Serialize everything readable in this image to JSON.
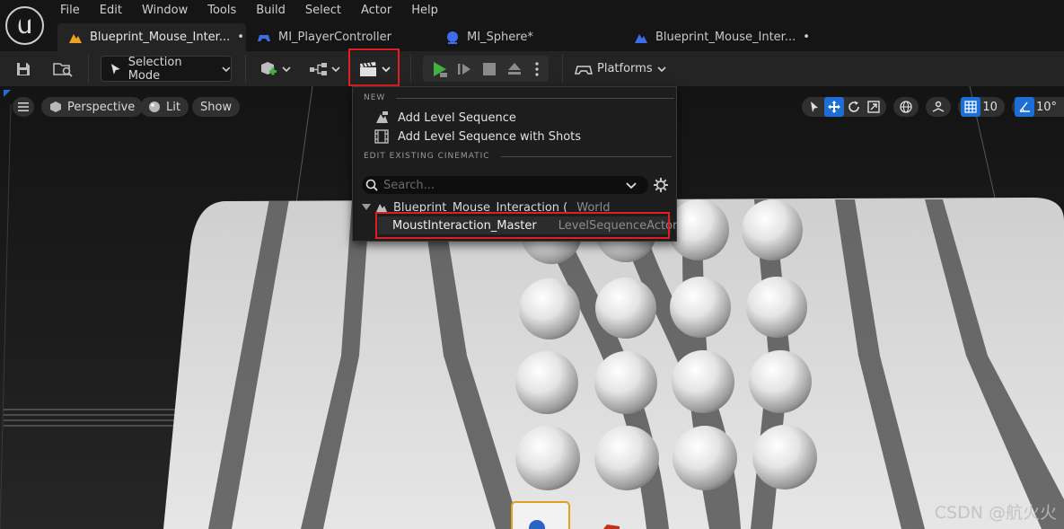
{
  "menubar": {
    "items": [
      "File",
      "Edit",
      "Window",
      "Tools",
      "Build",
      "Select",
      "Actor",
      "Help"
    ]
  },
  "tabs": [
    {
      "label": "Blueprint_Mouse_Inter...",
      "modified": "•",
      "icon": "level-icon",
      "icon_color": "#f0a020",
      "active": true
    },
    {
      "label": "MI_PlayerController",
      "modified": "",
      "icon": "gamepad-icon",
      "icon_color": "#3b6ee8",
      "active": false
    },
    {
      "label": "MI_Sphere",
      "modified": "*",
      "icon": "material-sphere-icon",
      "icon_color": "#3b6ee8",
      "active": false
    },
    {
      "label": "Blueprint_Mouse_Inter...",
      "modified": "•",
      "icon": "level-icon",
      "icon_color": "#3b6ee8",
      "active": false
    }
  ],
  "toolbar": {
    "selection_mode_label": "Selection Mode",
    "platforms_label": "Platforms"
  },
  "viewport": {
    "perspective_label": "Perspective",
    "lit_label": "Lit",
    "show_label": "Show",
    "grid_snap_value": "10",
    "rotation_snap_value": "10°"
  },
  "cinematics_menu": {
    "new_heading": "NEW",
    "add_level_sequence": "Add Level Sequence",
    "add_level_sequence_with_shots": "Add Level Sequence with Shots",
    "edit_heading": "EDIT EXISTING CINEMATIC",
    "search_placeholder": "Search...",
    "tree": {
      "world_name": "Blueprint_Mouse_Interaction (",
      "world_type": "World",
      "sequence_name": "MoustInteraction_Master",
      "sequence_type": "LevelSequenceActor"
    }
  },
  "watermark": "CSDN @航火火",
  "colors": {
    "accent_blue": "#1d6fd6",
    "highlight_red": "#e02020",
    "play_green": "#3fb23f"
  }
}
